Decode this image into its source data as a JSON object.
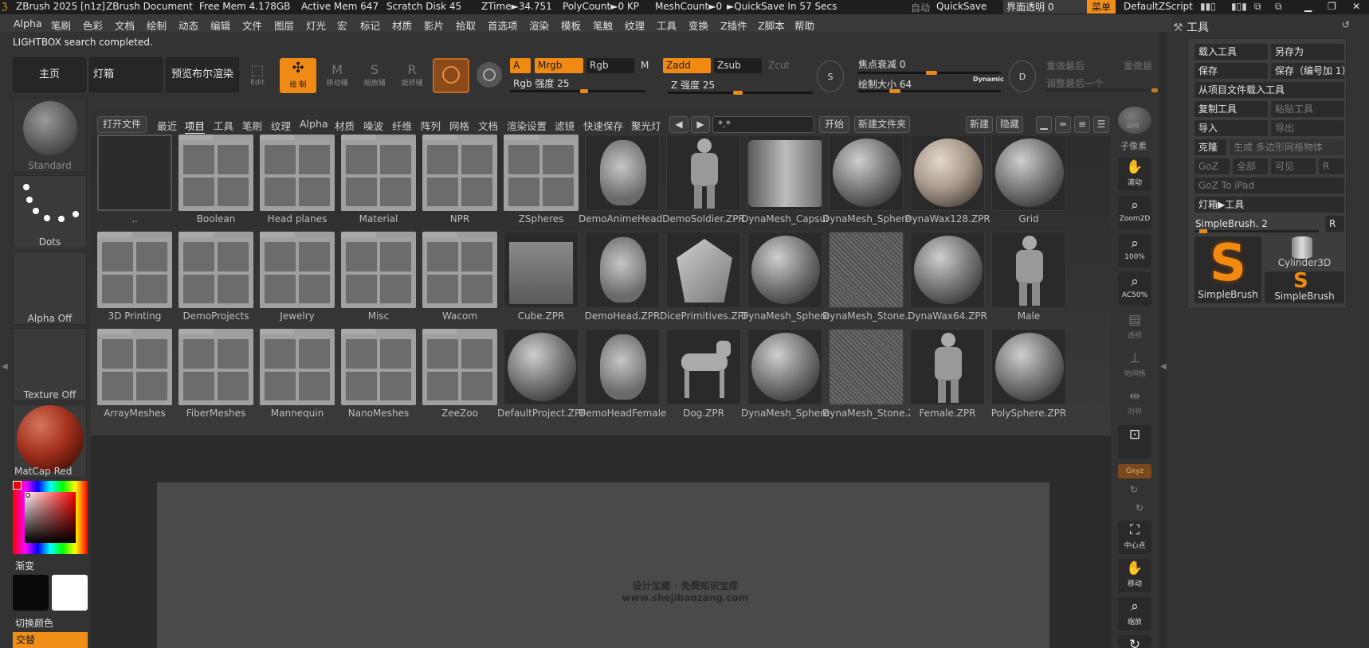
{
  "titlebar": {
    "app": "ZBrush 2025 [n1z]",
    "document": "ZBrush Document",
    "free_mem": "Free Mem 4.178GB",
    "active_mem": "Active Mem 647",
    "scratch": "Scratch Disk 45",
    "ztime": "ZTime►34.751",
    "polycount": "PolyCount►0 KP",
    "meshcount": "MeshCount►0",
    "quicksave_in": "►QuickSave In 57 Secs",
    "auto": "自动",
    "quicksave": "QuickSave",
    "ui_transparency": "界面透明 0",
    "menu": "菜单",
    "script": "DefaultZScript"
  },
  "menu": [
    "Alpha",
    "笔刷",
    "色彩",
    "文档",
    "绘制",
    "动态",
    "编辑",
    "文件",
    "图层",
    "灯光",
    "宏",
    "标记",
    "材质",
    "影片",
    "拾取",
    "首选项",
    "渲染",
    "模板",
    "笔触",
    "纹理",
    "工具",
    "变换",
    "Z插件",
    "Z脚本",
    "帮助"
  ],
  "status": "LIGHTBOX search completed.",
  "top_left_buttons": {
    "home": "主页",
    "lightbox": "灯箱",
    "bool_preview": "预览布尔渲染"
  },
  "mode_buttons": {
    "edit": "Edit",
    "draw": "绘 制",
    "move": "移动辅",
    "scale": "缩放辅",
    "rotate": "旋转辅"
  },
  "channels": {
    "a": "A",
    "mrgb": "Mrgb",
    "rgb": "Rgb",
    "m": "M",
    "zadd": "Zadd",
    "zsub": "Zsub",
    "zcut": "Zcut"
  },
  "sliders": {
    "rgb_intensity": "Rgb 强度 25",
    "z_intensity": "Z 强度 25",
    "focal_shift": "焦点衰减 0",
    "draw_size": "绘制大小 64",
    "dynamic": "Dynamic",
    "s": "S",
    "d": "D",
    "redo_last": "重做最后",
    "redo_last2": "重做最",
    "adjust_last": "调整最后一个"
  },
  "left_shelf": {
    "brush": "Standard",
    "stroke": "Dots",
    "alpha": "Alpha Off",
    "texture": "Texture Off",
    "material": "MatCap Red Wax",
    "gradient": "渐变",
    "switch_color": "切换颜色",
    "alternate": "交替",
    "colors": {
      "material": "#a2301c",
      "main": "#0a0a0a",
      "secondary": "#ffffff"
    }
  },
  "lightbox": {
    "open_file": "打开文件",
    "tabs": [
      "最近",
      "项目",
      "工具",
      "笔刷",
      "纹理",
      "Alpha",
      "材质",
      "噪波",
      "纤维",
      "阵列",
      "网格",
      "文档",
      "渲染设置",
      "滤镜",
      "快速保存",
      "聚光灯"
    ],
    "selected_tab": "项目",
    "search": "*.*",
    "start": "开始",
    "new_folder": "新建文件夹",
    "new": "新建",
    "hide": "隐藏",
    "rows": [
      [
        {
          "name": "..",
          "kind": "empty"
        },
        {
          "name": "Boolean",
          "kind": "folder"
        },
        {
          "name": "Head planes",
          "kind": "folder"
        },
        {
          "name": "Material",
          "kind": "folder"
        },
        {
          "name": "NPR",
          "kind": "folder"
        },
        {
          "name": "ZSpheres",
          "kind": "folder"
        },
        {
          "name": "DemoAnimeHead.ZPR",
          "kind": "head"
        },
        {
          "name": "DemoSoldier.ZPR",
          "kind": "figure"
        },
        {
          "name": "DynaMesh_Capsule.ZPR",
          "kind": "capsule"
        },
        {
          "name": "DynaMesh_Sphere.ZPR",
          "kind": "sphere"
        },
        {
          "name": "DynaWax128.ZPR",
          "kind": "wax"
        },
        {
          "name": "Grid",
          "kind": "sphere"
        }
      ],
      [
        {
          "name": "3D Printing",
          "kind": "folder"
        },
        {
          "name": "DemoProjects",
          "kind": "folder"
        },
        {
          "name": "Jewelry",
          "kind": "folder"
        },
        {
          "name": "Misc",
          "kind": "folder"
        },
        {
          "name": "Wacom",
          "kind": "folder"
        },
        {
          "name": "Cube.ZPR",
          "kind": "cube"
        },
        {
          "name": "DemoHead.ZPR",
          "kind": "head"
        },
        {
          "name": "DicePrimitives.ZPR",
          "kind": "dice"
        },
        {
          "name": "DynaMesh_Sphere.ZPR",
          "kind": "sphere"
        },
        {
          "name": "DynaMesh_Stone.ZPR",
          "kind": "stone"
        },
        {
          "name": "DynaWax64.ZPR",
          "kind": "sphere"
        },
        {
          "name": "Male",
          "kind": "figure"
        }
      ],
      [
        {
          "name": "ArrayMeshes",
          "kind": "folder"
        },
        {
          "name": "FiberMeshes",
          "kind": "folder"
        },
        {
          "name": "Mannequin",
          "kind": "folder"
        },
        {
          "name": "NanoMeshes",
          "kind": "folder"
        },
        {
          "name": "ZeeZoo",
          "kind": "folder"
        },
        {
          "name": "DefaultProject.ZPR",
          "kind": "sphere"
        },
        {
          "name": "DemoHeadFemale.ZPR",
          "kind": "head"
        },
        {
          "name": "Dog.ZPR",
          "kind": "dog"
        },
        {
          "name": "DynaMesh_Sphere.ZPR",
          "kind": "sphere"
        },
        {
          "name": "DynaMesh_Stone.ZPR",
          "kind": "stone"
        },
        {
          "name": "Female.ZPR",
          "kind": "figure"
        },
        {
          "name": "PolySphere.ZPR",
          "kind": "sphere"
        }
      ]
    ]
  },
  "right_shelf": {
    "bpr": "BPR",
    "subpixel": "子像素",
    "scroll": "滚动",
    "zoom2d": "Zoom2D",
    "zoom100": "100%",
    "ac50": "AC50%",
    "persp": "透视",
    "floor": "地网格",
    "sym": "对称",
    "xyz": "Gxyz",
    "center": "中心点",
    "move": "移动",
    "scale": "缩放"
  },
  "tool_panel": {
    "title": "工具",
    "load": "载入工具",
    "save_as": "另存为",
    "save": "保存",
    "save_inc": "保存（编号加 1）",
    "load_project": "从项目文件载入工具",
    "copy": "复制工具",
    "paste": "粘贴工具",
    "import": "导入",
    "export": "导出",
    "clone": "克隆",
    "make_polymesh": "生成 多边形网格物体",
    "goz": "GoZ",
    "all": "全部",
    "visible": "可见",
    "r": "R",
    "goz_ipad": "GoZ To iPad",
    "lightbox_tool": "灯箱▶工具",
    "current": "SimpleBrush. 2",
    "tool1": "SimpleBrush",
    "tool2": "Cylinder3D",
    "tool3": "SimpleBrush"
  },
  "watermark": {
    "line1": "设计宝藏 · 免费知识宝库",
    "line2": "www.shejibaozang.com"
  }
}
